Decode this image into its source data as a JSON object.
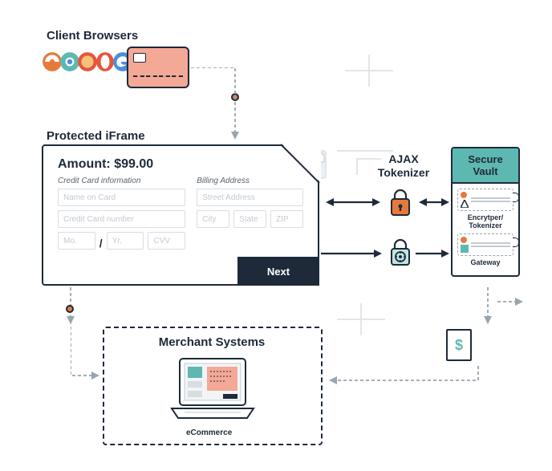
{
  "client": {
    "title": "Client Browsers",
    "browsers": [
      "internet-explorer",
      "chrome",
      "firefox",
      "opera",
      "edge"
    ]
  },
  "iframe": {
    "title": "Protected iFrame",
    "amount_label": "Amount:",
    "amount_value": "$99.00",
    "cc_label": "Credit Card information",
    "billing_label": "Billing Address",
    "placeholders": {
      "name": "Name on Card",
      "number": "Credit Card number",
      "month": "Mo.",
      "year": "Yr.",
      "cvv": "CVV",
      "street": "Street Address",
      "city": "City",
      "state": "State",
      "zip": "ZIP"
    },
    "next_label": "Next"
  },
  "ajax": {
    "title": "AJAX Tokenizer"
  },
  "vault": {
    "title": "Secure Vault",
    "encrypter_label": "Encrytper/ Tokenizer",
    "gateway_label": "Gateway"
  },
  "merchant": {
    "title": "Merchant Systems",
    "ecommerce_label": "eCommerce"
  },
  "stamp": {
    "symbol": "$"
  },
  "colors": {
    "navy": "#1e2a3a",
    "teal": "#5eb8b2",
    "coral": "#f4a896",
    "orange": "#e67a3b",
    "grey": "#9aa4af"
  }
}
